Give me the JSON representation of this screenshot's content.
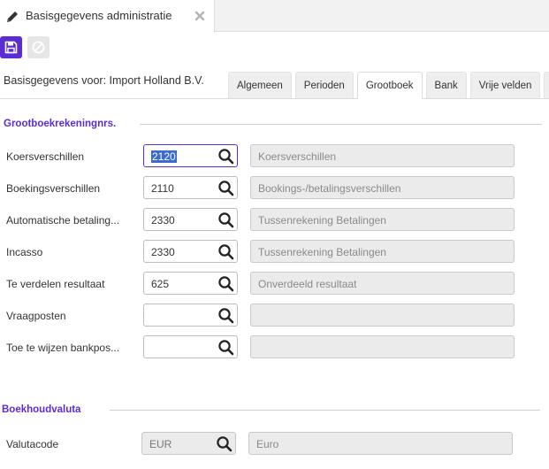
{
  "window_tab": {
    "title": "Basisgegevens administratie"
  },
  "header": {
    "for_label": "Basisgegevens voor: Import Holland B.V."
  },
  "tabs": [
    {
      "label": "Algemeen",
      "active": false
    },
    {
      "label": "Perioden",
      "active": false
    },
    {
      "label": "Grootboek",
      "active": true
    },
    {
      "label": "Bank",
      "active": false
    },
    {
      "label": "Vrije velden",
      "active": false
    },
    {
      "label": "L",
      "active": false
    }
  ],
  "section_ledger": {
    "title": "Grootboekrekeningnrs.",
    "rows": [
      {
        "label": "Koersverschillen",
        "code": "2120",
        "description": "Koersverschillen"
      },
      {
        "label": "Boekingsverschillen",
        "code": "2110",
        "description": "Bookings-/betalingsverschillen"
      },
      {
        "label": "Automatische betaling...",
        "code": "2330",
        "description": "Tussenrekening Betalingen"
      },
      {
        "label": "Incasso",
        "code": "2330",
        "description": "Tussenrekening Betalingen"
      },
      {
        "label": "Te verdelen resultaat",
        "code": "625",
        "description": "Onverdeeld resultaat"
      },
      {
        "label": "Vraagposten",
        "code": "",
        "description": ""
      },
      {
        "label": "Toe te wijzen bankpos...",
        "code": "",
        "description": ""
      }
    ]
  },
  "section_currency": {
    "title": "Boekhoudvaluta",
    "label": "Valutacode",
    "code": "EUR",
    "description": "Euro"
  },
  "colors": {
    "accent": "#5b2bd6",
    "selection": "#3a6bd1"
  }
}
